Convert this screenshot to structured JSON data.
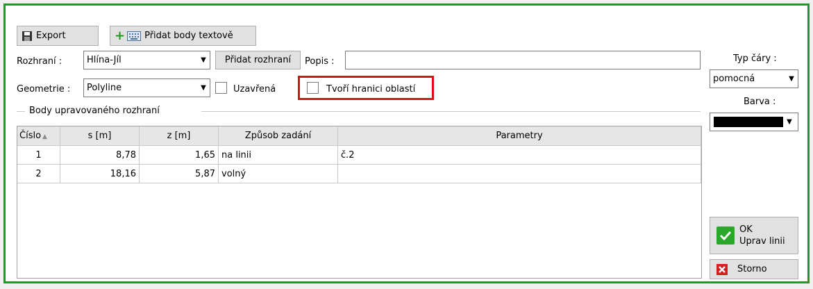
{
  "toolbar": {
    "export_label": "Export",
    "add_text_points_label": "Přidat body textově"
  },
  "interface": {
    "label": "Rozhraní :",
    "selected": "Hlína-Jíl",
    "add_button": "Přidat rozhraní",
    "desc_label": "Popis :",
    "desc_value": ""
  },
  "geometry": {
    "label": "Geometrie :",
    "selected": "Polyline",
    "closed_label": "Uzavřená",
    "closed_checked": false,
    "boundary_label": "Tvoří hranici oblastí",
    "boundary_checked": false
  },
  "group_title": "Body upravovaného rozhraní",
  "table": {
    "columns": [
      "Číslo",
      "s [m]",
      "z [m]",
      "Způsob zadání",
      "Parametry"
    ],
    "rows": [
      [
        "1",
        "8,78",
        "1,65",
        "na linii",
        "č.2"
      ],
      [
        "2",
        "18,16",
        "5,87",
        "volný",
        ""
      ]
    ]
  },
  "right_panel": {
    "line_type_label": "Typ čáry :",
    "line_type_value": "pomocná",
    "color_label": "Barva :",
    "color_value": "#000000"
  },
  "buttons": {
    "ok_line1": "OK",
    "ok_line2": "Uprav linii",
    "cancel": "Storno"
  },
  "colors": {
    "frame": "#1e9a1e",
    "highlight": "#e01010",
    "ok_green": "#2aa82a",
    "cancel_red": "#d42020"
  }
}
